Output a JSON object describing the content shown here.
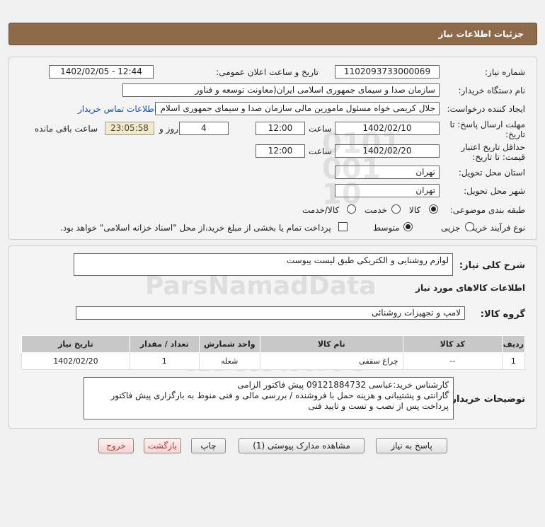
{
  "header": {
    "title": "جزئیات اطلاعات نیاز"
  },
  "info": {
    "need_number_label": "شماره نیاز:",
    "need_number": "1102093733000069",
    "announce_label": "تاریخ و ساعت اعلان عمومی:",
    "announce_value": "1402/02/05 - 12:44",
    "buyer_label": "نام دستگاه خریدار:",
    "buyer_value": "سازمان صدا و سیمای جمهوری اسلامی ایران(معاونت توسعه و فناور",
    "creator_label": "ایجاد کننده درخواست:",
    "creator_value": "جلال کریمی خواه مسئول مامورین مالی  سازمان صدا و سیمای جمهوری اسلام",
    "contact_link": "اطلاعات تماس خریدار",
    "deadline_label_1": "مهلت ارسال پاسخ: تا",
    "deadline_label_2": "تاریخ:",
    "deadline_date": "1402/02/10",
    "time_label": "ساعت",
    "deadline_time": "12:00",
    "days_value": "4",
    "days_label": "روز و",
    "remaining_time": "23:05:58",
    "remaining_label": "ساعت باقی مانده",
    "validity_label_1": "حداقل تاریخ اعتبار",
    "validity_label_2": "قیمت: تا تاریخ:",
    "validity_date": "1402/02/20",
    "validity_time_label": "ساعت",
    "validity_time": "12:00",
    "province_label": "استان محل تحویل:",
    "province_value": "تهران",
    "city_label": "شهر محل تحویل:",
    "city_value": "تهران",
    "category_label": "طبقه بندی موضوعی:",
    "category_options": [
      "کالا",
      "خدمت",
      "کالا/خدمت"
    ],
    "category_selected": "کالا",
    "process_label": "نوع فرآیند خرید :",
    "process_options": [
      "جزیی",
      "متوسط"
    ],
    "process_selected": "متوسط",
    "payment_note": "پرداخت تمام یا بخشی از مبلغ خرید،از محل \"اسناد خزانه اسلامی\" خواهد بود."
  },
  "summary": {
    "label": "شرح کلی نیاز:",
    "value": "لوازم روشنایی و الکتریکی طبق لیست پیوست"
  },
  "goods": {
    "section_title": "اطلاعات کالاهای مورد نیاز",
    "group_label": "گروه کالا:",
    "group_value": "لامپ و تجهیزات روشنائی",
    "columns": [
      "ردیف",
      "کد کالا",
      "نام کالا",
      "واحد شمارش",
      "تعداد / مقدار",
      "تاریخ نیاز"
    ],
    "rows": [
      [
        "1",
        "--",
        "چراغ سقفی",
        "شعله",
        "1",
        "1402/02/20"
      ]
    ]
  },
  "buyer_notes": {
    "label": "توضیحات خریدار:",
    "lines": [
      "کارشناس خرید:عباسی 09121884732  پیش فاکتور الزامی",
      "گارانتی و پشتیبانی و هزینه حمل با فروشنده / بررسی مالی و فنی منوط به بارگزاری پیش فاکتور",
      "پرداخت پس از نصب و تست و تایید فنی"
    ]
  },
  "buttons": {
    "reply": "پاسخ به نیاز",
    "attachments": "مشاهده مدارک پیوستی (1)",
    "print": "چاپ",
    "back": "بازگشت",
    "exit": "خروج"
  }
}
